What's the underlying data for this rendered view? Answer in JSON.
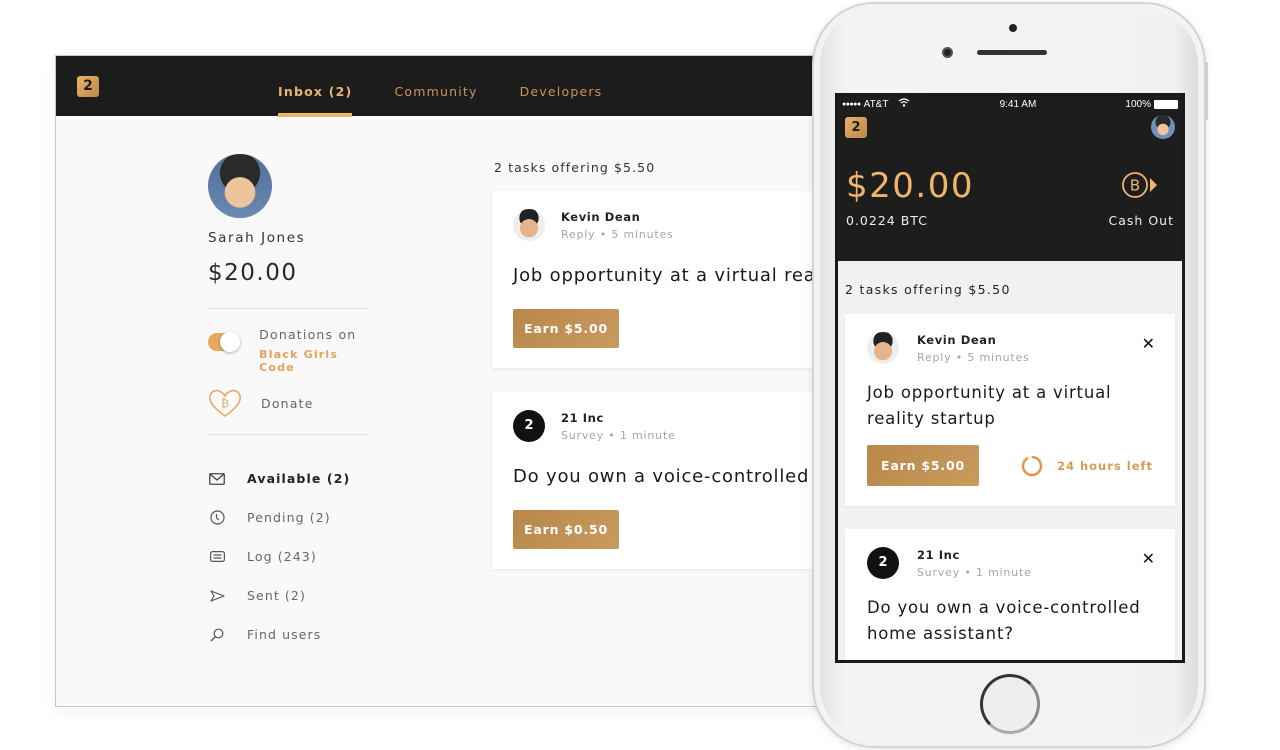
{
  "colors": {
    "accent": "#e8b571",
    "dark": "#1c1c1c",
    "button": "#c0904f"
  },
  "desktop": {
    "logo": "2",
    "nav": [
      {
        "label": "Inbox (2)",
        "active": true
      },
      {
        "label": "Community",
        "active": false
      },
      {
        "label": "Developers",
        "active": false
      }
    ],
    "profile": {
      "name": "Sarah Jones",
      "balance": "$20.00",
      "donations_label": "Donations on",
      "donations_org": "Black Girls Code",
      "donations_enabled": true,
      "donate_label": "Donate"
    },
    "menu": [
      {
        "icon": "mail-icon",
        "label": "Available (2)",
        "active": true
      },
      {
        "icon": "clock-icon",
        "label": "Pending (2)",
        "active": false
      },
      {
        "icon": "log-icon",
        "label": "Log (243)",
        "active": false
      },
      {
        "icon": "send-icon",
        "label": "Sent (2)",
        "active": false
      },
      {
        "icon": "search-icon",
        "label": "Find users",
        "active": false
      }
    ],
    "feed": {
      "summary": "2 tasks offering $5.50",
      "cards": [
        {
          "sender": "Kevin Dean",
          "type": "Reply",
          "time": "5 minutes",
          "sub": "Reply • 5 minutes",
          "title": "Job opportunity at a virtual reality startup",
          "button": "Earn $5.00"
        },
        {
          "sender": "21 Inc",
          "type": "Survey",
          "time": "1 minute",
          "sub": "Survey • 1 minute",
          "title": "Do you own a voice-controlled home assistant?",
          "button": "Earn $0.50"
        }
      ]
    }
  },
  "phone": {
    "status": {
      "carrier": "AT&T",
      "signal": "●●●●●",
      "time": "9:41 AM",
      "battery": "100%"
    },
    "logo": "2",
    "balance": "$20.00",
    "btc": "0.0224 BTC",
    "cashout_label": "Cash Out",
    "feed": {
      "summary": "2 tasks offering $5.50",
      "cards": [
        {
          "sender": "Kevin Dean",
          "sub": "Reply • 5 minutes",
          "title": "Job opportunity at a virtual reality startup",
          "button": "Earn $5.00",
          "timer": "24 hours left",
          "timer_progress": 0.92,
          "close": "✕"
        },
        {
          "sender": "21 Inc",
          "sub": "Survey • 1 minute",
          "title": "Do you own a voice-controlled home assistant?",
          "close": "✕"
        }
      ]
    }
  }
}
